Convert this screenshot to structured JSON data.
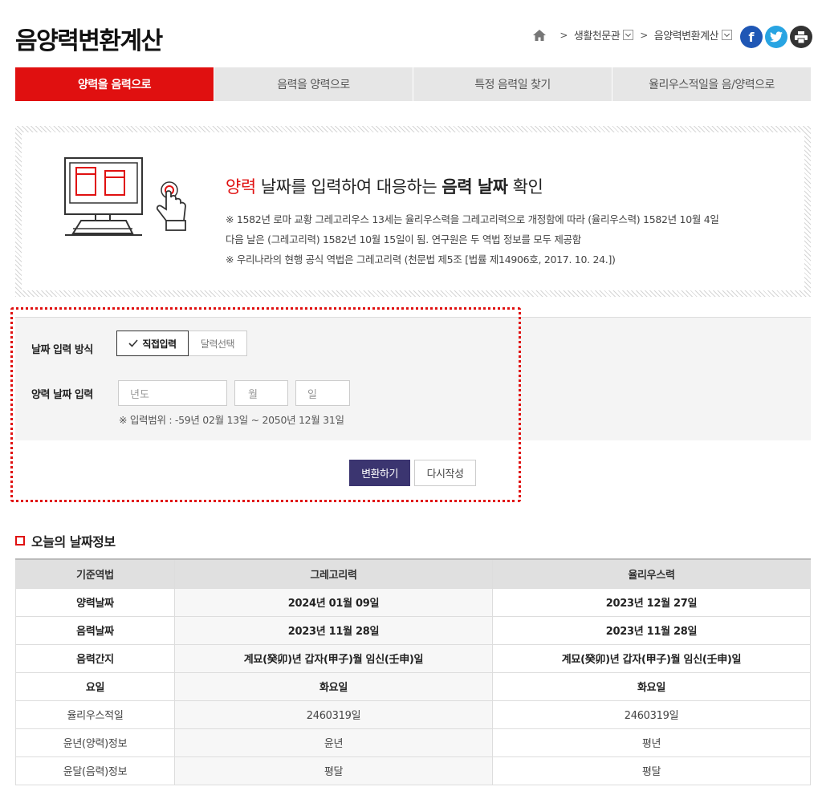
{
  "page_title": "음양력변환계산",
  "breadcrumb": {
    "item1": "생활천문관",
    "item2": "음양력변환계산"
  },
  "social": {
    "facebook": "f",
    "twitter": "t",
    "print": "print"
  },
  "tabs": [
    "양력을 음력으로",
    "음력을 양력으로",
    "특정 음력일 찾기",
    "율리우스적일을 음/양력으로"
  ],
  "intro": {
    "h_red": "양력",
    "h_mid1": " 날짜를 입력하여 대응하는 ",
    "h_bold": "음력 날짜",
    "h_end": " 확인",
    "note1": "※ 1582년 로마 교황 그레고리우스 13세는 율리우스력을 그레고리력으로 개정함에 따라 (율리우스력) 1582년 10월 4일",
    "note2": "다음 날은 (그레고리력) 1582년 10월 15일이 됨. 연구원은 두 역법 정보를 모두 제공함",
    "note3": "※ 우리나라의 현행 공식 역법은 그레고리력 (천문법 제5조 [법률 제14906호, 2017. 10. 24.])"
  },
  "form": {
    "method_label": "날짜 입력 방식",
    "opt_direct": "직접입력",
    "opt_calendar": "달력선택",
    "date_label": "양력 날짜 입력",
    "ph_year": "년도",
    "ph_month": "월",
    "ph_day": "일",
    "range": "※ 입력범위 : -59년 02월 13일 ~ 2050년 12월 31일",
    "convert": "변환하기",
    "reset": "다시작성"
  },
  "today": {
    "title": "오늘의 날짜정보",
    "headers": [
      "기준역법",
      "그레고리력",
      "율리우스력"
    ],
    "rows": [
      [
        "양력날짜",
        "2024년 01월 09일",
        "2023년 12월 27일"
      ],
      [
        "음력날짜",
        "2023년 11월 28일",
        "2023년 11월 28일"
      ],
      [
        "음력간지",
        "계묘(癸卯)년 갑자(甲子)월 임신(壬申)일",
        "계묘(癸卯)년 갑자(甲子)월 임신(壬申)일"
      ],
      [
        "요일",
        "화요일",
        "화요일"
      ],
      [
        "율리우스적일",
        "2460319일",
        "2460319일"
      ],
      [
        "윤년(양력)정보",
        "윤년",
        "평년"
      ],
      [
        "윤달(음력)정보",
        "평달",
        "평달"
      ]
    ]
  },
  "colors": {
    "accent": "#e01010",
    "convert_button": "#3b3570"
  }
}
